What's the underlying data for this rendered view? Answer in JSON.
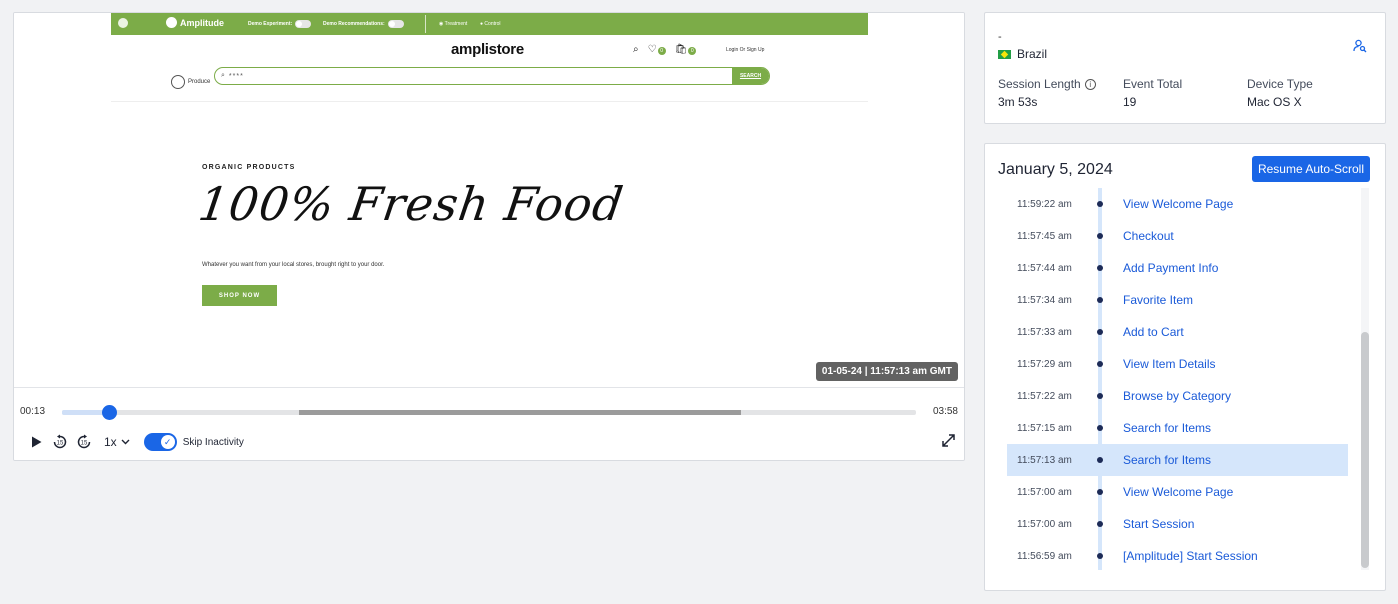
{
  "player": {
    "site": {
      "topbar": {
        "logo_text": "Amplitude",
        "experiment_label": "Demo Experiment:",
        "recommendations_label": "Demo Recommendations:",
        "treatment_label": "Treatment",
        "control_label": "Control"
      },
      "brand": "amplistore",
      "wishlist_count": "0",
      "cart_count": "0",
      "login_label": "Login Or Sign Up",
      "nav_label": "Produce",
      "search_value": "****",
      "search_button": "SEARCH",
      "hero_kicker": "ORGANIC PRODUCTS",
      "hero_title": "100% Fresh Food",
      "hero_subtitle": "Whatever you want from your local stores, brought right to your door.",
      "hero_cta": "SHOP NOW"
    },
    "timestamp": "01-05-24 | 11:57:13 am GMT",
    "current_time": "00:13",
    "total_time": "03:58",
    "progress_fraction": 0.055,
    "active_segment": {
      "start_fraction": 0.278,
      "end_fraction": 0.795
    },
    "speed": "1x",
    "skip_inactivity_label": "Skip Inactivity",
    "skip_inactivity_on": true
  },
  "user": {
    "name": "-",
    "country": "Brazil",
    "stats": [
      {
        "label": "Session Length",
        "value": "3m 53s",
        "has_info": true
      },
      {
        "label": "Event Total",
        "value": "19",
        "has_info": false
      },
      {
        "label": "Device Type",
        "value": "Mac OS X",
        "has_info": false
      }
    ]
  },
  "events": {
    "date": "January 5, 2024",
    "resume_label": "Resume Auto-Scroll",
    "items": [
      {
        "time": "11:59:22 am",
        "name": "View Welcome Page",
        "selected": false
      },
      {
        "time": "11:57:45 am",
        "name": "Checkout",
        "selected": false
      },
      {
        "time": "11:57:44 am",
        "name": "Add Payment Info",
        "selected": false
      },
      {
        "time": "11:57:34 am",
        "name": "Favorite Item",
        "selected": false
      },
      {
        "time": "11:57:33 am",
        "name": "Add to Cart",
        "selected": false
      },
      {
        "time": "11:57:29 am",
        "name": "View Item Details",
        "selected": false
      },
      {
        "time": "11:57:22 am",
        "name": "Browse by Category",
        "selected": false
      },
      {
        "time": "11:57:15 am",
        "name": "Search for Items",
        "selected": false
      },
      {
        "time": "11:57:13 am",
        "name": "Search for Items",
        "selected": true
      },
      {
        "time": "11:57:00 am",
        "name": "View Welcome Page",
        "selected": false
      },
      {
        "time": "11:57:00 am",
        "name": "Start Session",
        "selected": false
      },
      {
        "time": "11:56:59 am",
        "name": "[Amplitude] Start Session",
        "selected": false
      }
    ]
  },
  "colors": {
    "accent": "#1a66e6",
    "brand_green": "#7cac48",
    "selected_row": "#d5e6fb"
  }
}
